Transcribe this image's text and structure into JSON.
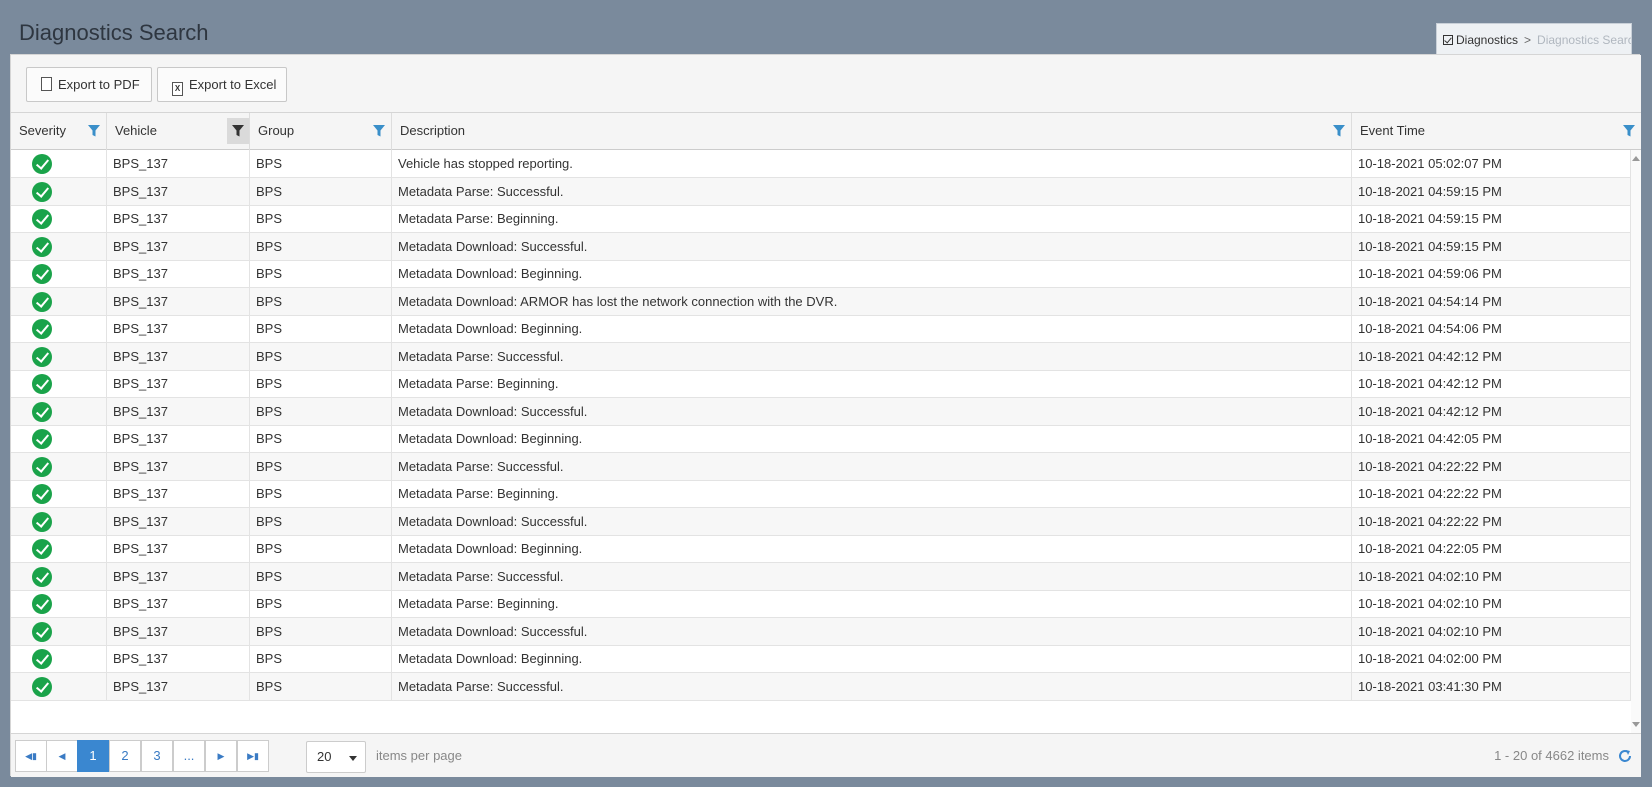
{
  "page": {
    "title": "Diagnostics Search"
  },
  "breadcrumb": {
    "root": "Diagnostics",
    "separator": ">",
    "current": "Diagnostics Search"
  },
  "toolbar": {
    "export_pdf": "Export to PDF",
    "export_excel": "Export to Excel"
  },
  "grid": {
    "columns": [
      "Severity",
      "Vehicle",
      "Group",
      "Description",
      "Event Time"
    ],
    "rows": [
      {
        "vehicle": "BPS_137",
        "group": "BPS",
        "description": "Vehicle has stopped reporting.",
        "time": "10-18-2021 05:02:07 PM"
      },
      {
        "vehicle": "BPS_137",
        "group": "BPS",
        "description": "Metadata Parse: Successful.",
        "time": "10-18-2021 04:59:15 PM"
      },
      {
        "vehicle": "BPS_137",
        "group": "BPS",
        "description": "Metadata Parse: Beginning.",
        "time": "10-18-2021 04:59:15 PM"
      },
      {
        "vehicle": "BPS_137",
        "group": "BPS",
        "description": "Metadata Download: Successful.",
        "time": "10-18-2021 04:59:15 PM"
      },
      {
        "vehicle": "BPS_137",
        "group": "BPS",
        "description": "Metadata Download: Beginning.",
        "time": "10-18-2021 04:59:06 PM"
      },
      {
        "vehicle": "BPS_137",
        "group": "BPS",
        "description": "Metadata Download: ARMOR has lost the network connection with the DVR.",
        "time": "10-18-2021 04:54:14 PM"
      },
      {
        "vehicle": "BPS_137",
        "group": "BPS",
        "description": "Metadata Download: Beginning.",
        "time": "10-18-2021 04:54:06 PM"
      },
      {
        "vehicle": "BPS_137",
        "group": "BPS",
        "description": "Metadata Parse: Successful.",
        "time": "10-18-2021 04:42:12 PM"
      },
      {
        "vehicle": "BPS_137",
        "group": "BPS",
        "description": "Metadata Parse: Beginning.",
        "time": "10-18-2021 04:42:12 PM"
      },
      {
        "vehicle": "BPS_137",
        "group": "BPS",
        "description": "Metadata Download: Successful.",
        "time": "10-18-2021 04:42:12 PM"
      },
      {
        "vehicle": "BPS_137",
        "group": "BPS",
        "description": "Metadata Download: Beginning.",
        "time": "10-18-2021 04:42:05 PM"
      },
      {
        "vehicle": "BPS_137",
        "group": "BPS",
        "description": "Metadata Parse: Successful.",
        "time": "10-18-2021 04:22:22 PM"
      },
      {
        "vehicle": "BPS_137",
        "group": "BPS",
        "description": "Metadata Parse: Beginning.",
        "time": "10-18-2021 04:22:22 PM"
      },
      {
        "vehicle": "BPS_137",
        "group": "BPS",
        "description": "Metadata Download: Successful.",
        "time": "10-18-2021 04:22:22 PM"
      },
      {
        "vehicle": "BPS_137",
        "group": "BPS",
        "description": "Metadata Download: Beginning.",
        "time": "10-18-2021 04:22:05 PM"
      },
      {
        "vehicle": "BPS_137",
        "group": "BPS",
        "description": "Metadata Parse: Successful.",
        "time": "10-18-2021 04:02:10 PM"
      },
      {
        "vehicle": "BPS_137",
        "group": "BPS",
        "description": "Metadata Parse: Beginning.",
        "time": "10-18-2021 04:02:10 PM"
      },
      {
        "vehicle": "BPS_137",
        "group": "BPS",
        "description": "Metadata Download: Successful.",
        "time": "10-18-2021 04:02:10 PM"
      },
      {
        "vehicle": "BPS_137",
        "group": "BPS",
        "description": "Metadata Download: Beginning.",
        "time": "10-18-2021 04:02:00 PM"
      },
      {
        "vehicle": "BPS_137",
        "group": "BPS",
        "description": "Metadata Parse: Successful.",
        "time": "10-18-2021 03:41:30 PM"
      }
    ],
    "severity_icon": "check-circle-icon",
    "severity_color": "#1aa34a"
  },
  "pager": {
    "pages": [
      "1",
      "2",
      "3",
      "..."
    ],
    "current_page": "1",
    "page_size": "20",
    "items_per_page_label": "items per page",
    "info": "1 - 20 of 4662 items"
  },
  "colors": {
    "accent": "#3a87d0",
    "filter_icon": "#3a8fc9",
    "header_bg": "#7a8a9c"
  }
}
